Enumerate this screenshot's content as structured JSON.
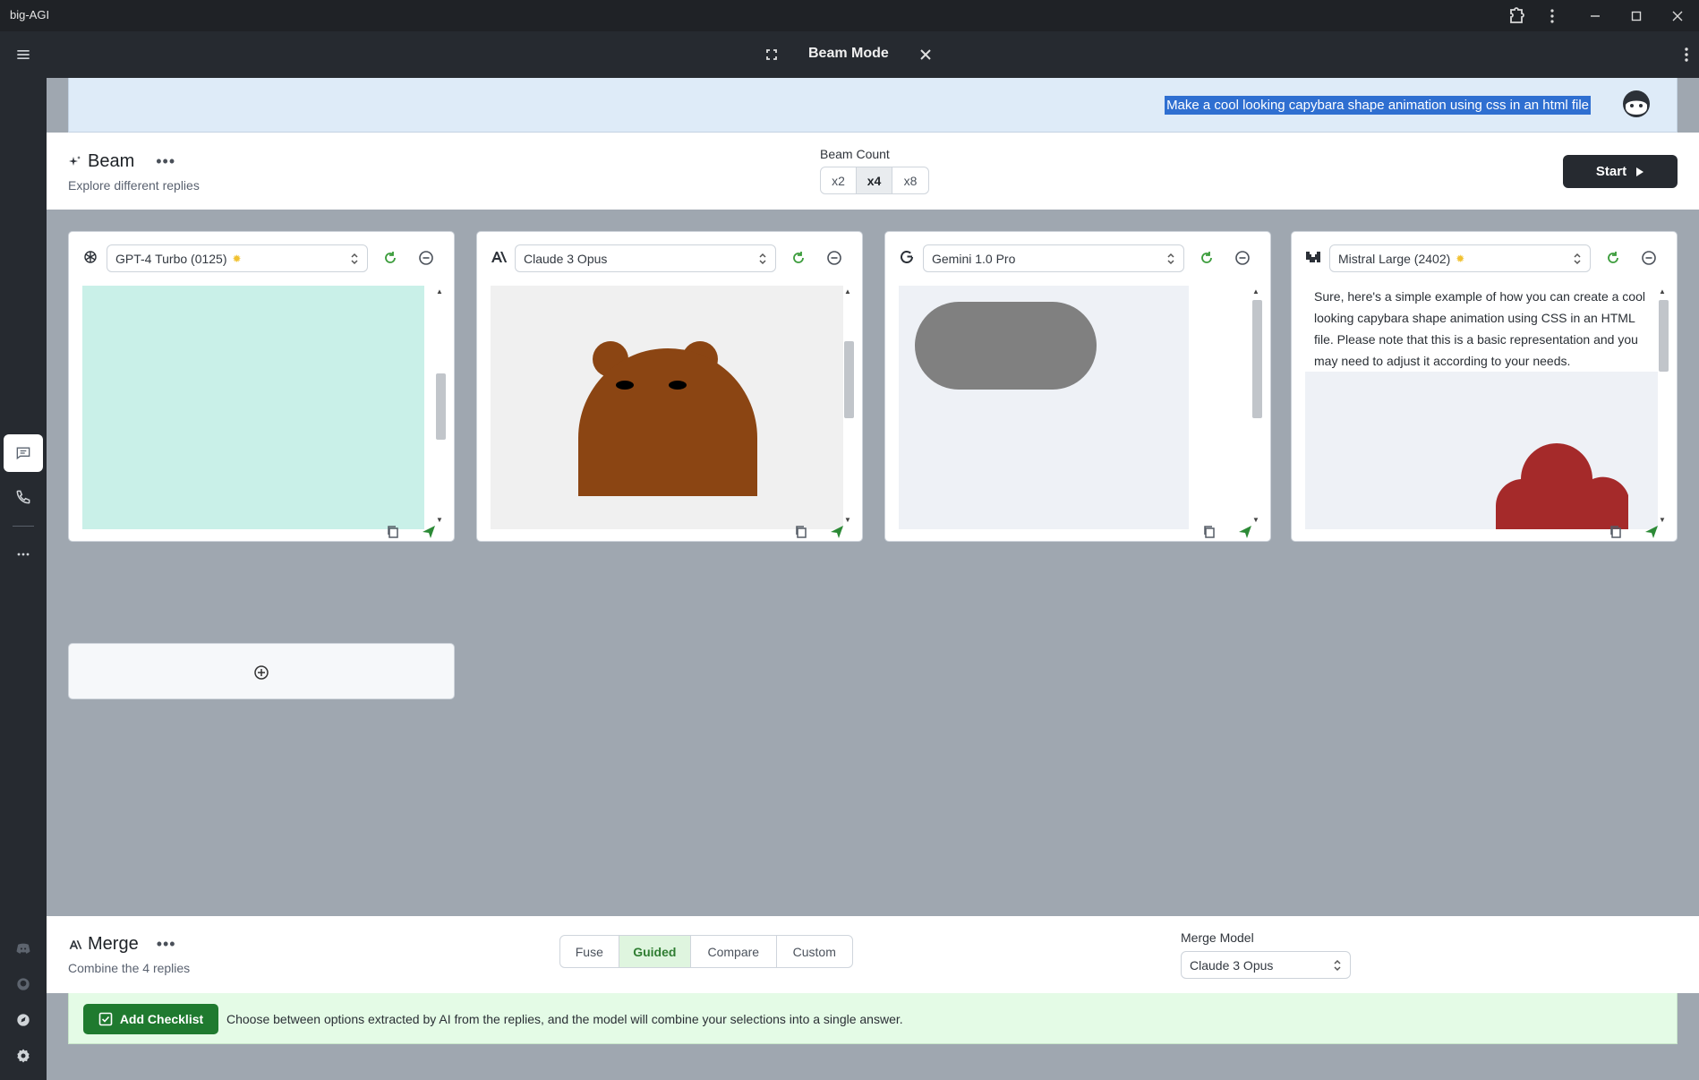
{
  "window": {
    "app_title": "big-AGI"
  },
  "header": {
    "title": "Beam Mode"
  },
  "user_message": {
    "text": "Make a cool looking capybara shape animation using css in an html file"
  },
  "beam": {
    "title": "Beam",
    "subtitle": "Explore different replies",
    "count_label": "Beam Count",
    "count_options": [
      "x2",
      "x4",
      "x8"
    ],
    "count_selected": "x4",
    "start_label": "Start"
  },
  "rays": [
    {
      "model": "GPT-4 Turbo (0125)",
      "icon": "openai-icon",
      "starred": true
    },
    {
      "model": "Claude 3 Opus",
      "icon": "anthropic-icon",
      "starred": false
    },
    {
      "model": "Gemini 1.0 Pro",
      "icon": "google-icon",
      "starred": false
    },
    {
      "model": "Mistral Large (2402)",
      "icon": "mistral-icon",
      "starred": true,
      "text": "Sure, here's a simple example of how you can create a cool looking capybara shape animation using CSS in an HTML file. Please note that this is a basic representation and you may need to adjust it according to your needs."
    }
  ],
  "merge": {
    "title": "Merge",
    "subtitle": "Combine the 4 replies",
    "methods": [
      "Fuse",
      "Guided",
      "Compare",
      "Custom"
    ],
    "method_selected": "Guided",
    "model_label": "Merge Model",
    "model": "Claude 3 Opus",
    "checklist_button": "Add Checklist",
    "description": "Choose between options extracted by AI from the replies, and the model will combine your selections into a single answer."
  },
  "colors": {
    "accent_green": "#1f7a2f",
    "selection_blue": "#2f6fd1",
    "capybara_brown": "#8b4513",
    "mistral_red": "#a52a2a",
    "gpt_bg": "#c9f0e8"
  }
}
